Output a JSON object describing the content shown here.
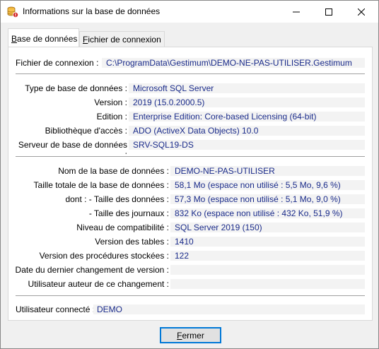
{
  "window": {
    "title": "Informations sur la base de données"
  },
  "tabs": [
    {
      "label_prefix": "",
      "label_underline": "B",
      "label_rest": "ase de données"
    },
    {
      "label_prefix": "",
      "label_underline": "F",
      "label_rest": "ichier de connexion"
    }
  ],
  "file": {
    "label": "Fichier de connexion :",
    "value": "C:\\ProgramData\\Gestimum\\DEMO-NE-PAS-UTILISER.Gestimum"
  },
  "server": {
    "type_label": "Type de base de données :",
    "type_value": "Microsoft SQL Server",
    "version_label": "Version :",
    "version_value": "2019 (15.0.2000.5)",
    "edition_label": "Edition :",
    "edition_value": "Enterprise Edition: Core-based Licensing (64-bit)",
    "library_label": "Bibliothèque d'accès :",
    "library_value": "ADO (ActiveX Data Objects) 10.0",
    "server_label": "Serveur de base de données :",
    "server_value": "SRV-SQL19-DS"
  },
  "database": {
    "name_label": "Nom de la base de données :",
    "name_value": "DEMO-NE-PAS-UTILISER",
    "size_label": "Taille totale de la base de données :",
    "size_value": "58,1 Mo (espace non utilisé : 5,5 Mo, 9,6 %)",
    "data_size_label": "dont :  - Taille des données :",
    "data_size_value": "57,3 Mo (espace non utilisé : 5,1 Mo, 9,0 %)",
    "log_size_label": "- Taille des journaux :",
    "log_size_value": "832 Ko (espace non utilisé : 432 Ko, 51,9 %)",
    "compat_label": "Niveau de compatibilité :",
    "compat_value": "SQL Server 2019 (150)",
    "tables_version_label": "Version des tables :",
    "tables_version_value": "1410",
    "procs_version_label": "Version des procédures stockées :",
    "procs_version_value": "122",
    "last_change_label": "Date du dernier changement de version :",
    "last_change_value": "",
    "change_user_label": "Utilisateur auteur de ce changement :",
    "change_user_value": ""
  },
  "connected": {
    "label": "Utilisateur connecté :",
    "value": "DEMO"
  },
  "close_button": {
    "label_underline": "F",
    "label_rest": "ermer"
  }
}
